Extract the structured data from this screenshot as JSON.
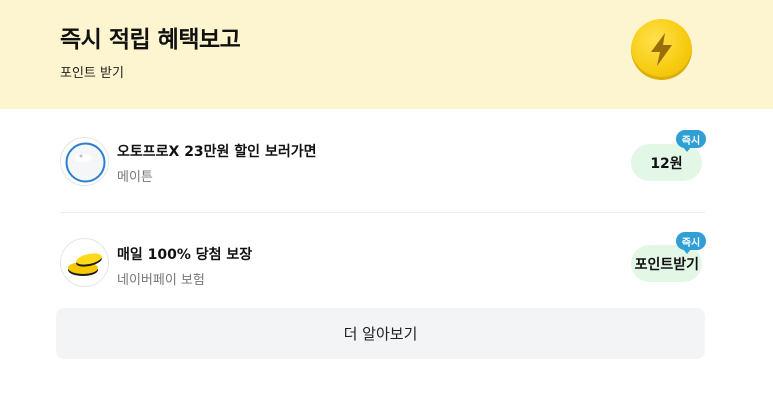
{
  "header": {
    "title": "즉시 적립 혜택보고",
    "subtitle": "포인트 받기",
    "icon": "lightning-coin-icon",
    "accent": "#fdf5cf"
  },
  "items": [
    {
      "title": "오토프로X 23만원 할인 보러가면",
      "brand": "메이튼",
      "reward": "12원",
      "badge": "즉시",
      "icon": "product-thumbnail"
    },
    {
      "title": "매일 100% 당첨 보장",
      "brand": "네이버페이 보험",
      "reward": "포인트받기",
      "badge": "즉시",
      "icon": "coins-thumbnail"
    }
  ],
  "more_button": {
    "label": "더 알아보기"
  },
  "colors": {
    "badge": "#2f9fd6",
    "reward_bg": "#e3f7e6",
    "button_bg": "#f3f4f6"
  }
}
